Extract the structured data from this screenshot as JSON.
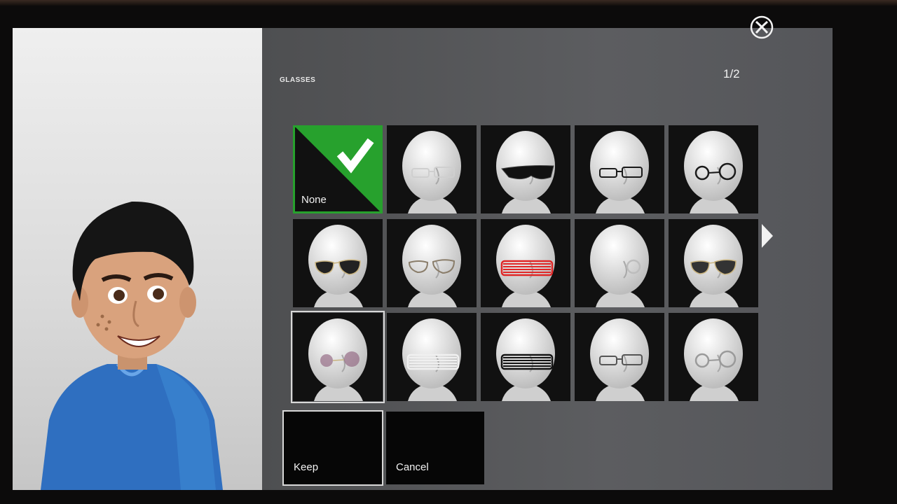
{
  "panel": {
    "heading": "GLASSES",
    "pager": "1/2"
  },
  "grid": {
    "none_label": "None",
    "items": [
      {
        "name": "none",
        "style": "none",
        "color": "#27a12d"
      },
      {
        "name": "rectangular-clear",
        "style": "rect",
        "color": "#cfcfcf"
      },
      {
        "name": "dark-wraparound",
        "style": "wrap",
        "color": "#111111"
      },
      {
        "name": "black-rectangular",
        "style": "rect",
        "color": "#1a1a1a"
      },
      {
        "name": "round-black",
        "style": "round",
        "color": "#1a1a1a"
      },
      {
        "name": "aviator-dark",
        "style": "aviator",
        "color": "#222222"
      },
      {
        "name": "aviator-clear",
        "style": "aviatorclear",
        "color": "#8a7d6a"
      },
      {
        "name": "red-shutter",
        "style": "shutter",
        "color": "#e02626"
      },
      {
        "name": "monocle",
        "style": "monocle",
        "color": "#bdbdbd"
      },
      {
        "name": "aviator-gradient",
        "style": "aviator",
        "color": "#333333"
      },
      {
        "name": "tinted-round",
        "style": "tinted",
        "color": "#8a5a78"
      },
      {
        "name": "white-shutter",
        "style": "shutter",
        "color": "#f0f0f0"
      },
      {
        "name": "black-shutter",
        "style": "shutter",
        "color": "#141414"
      },
      {
        "name": "half-rim",
        "style": "rect",
        "color": "#555555"
      },
      {
        "name": "wire-round",
        "style": "round",
        "color": "#9a9a9a"
      }
    ]
  },
  "actions": {
    "keep_label": "Keep",
    "cancel_label": "Cancel"
  },
  "icons": {
    "brand": "xbox-logo-icon",
    "selected": "checkmark-icon",
    "next": "chevron-right-icon"
  },
  "colors": {
    "accent": "#27a12d",
    "tile_bg": "#111111",
    "panel_bg": "#545557"
  }
}
